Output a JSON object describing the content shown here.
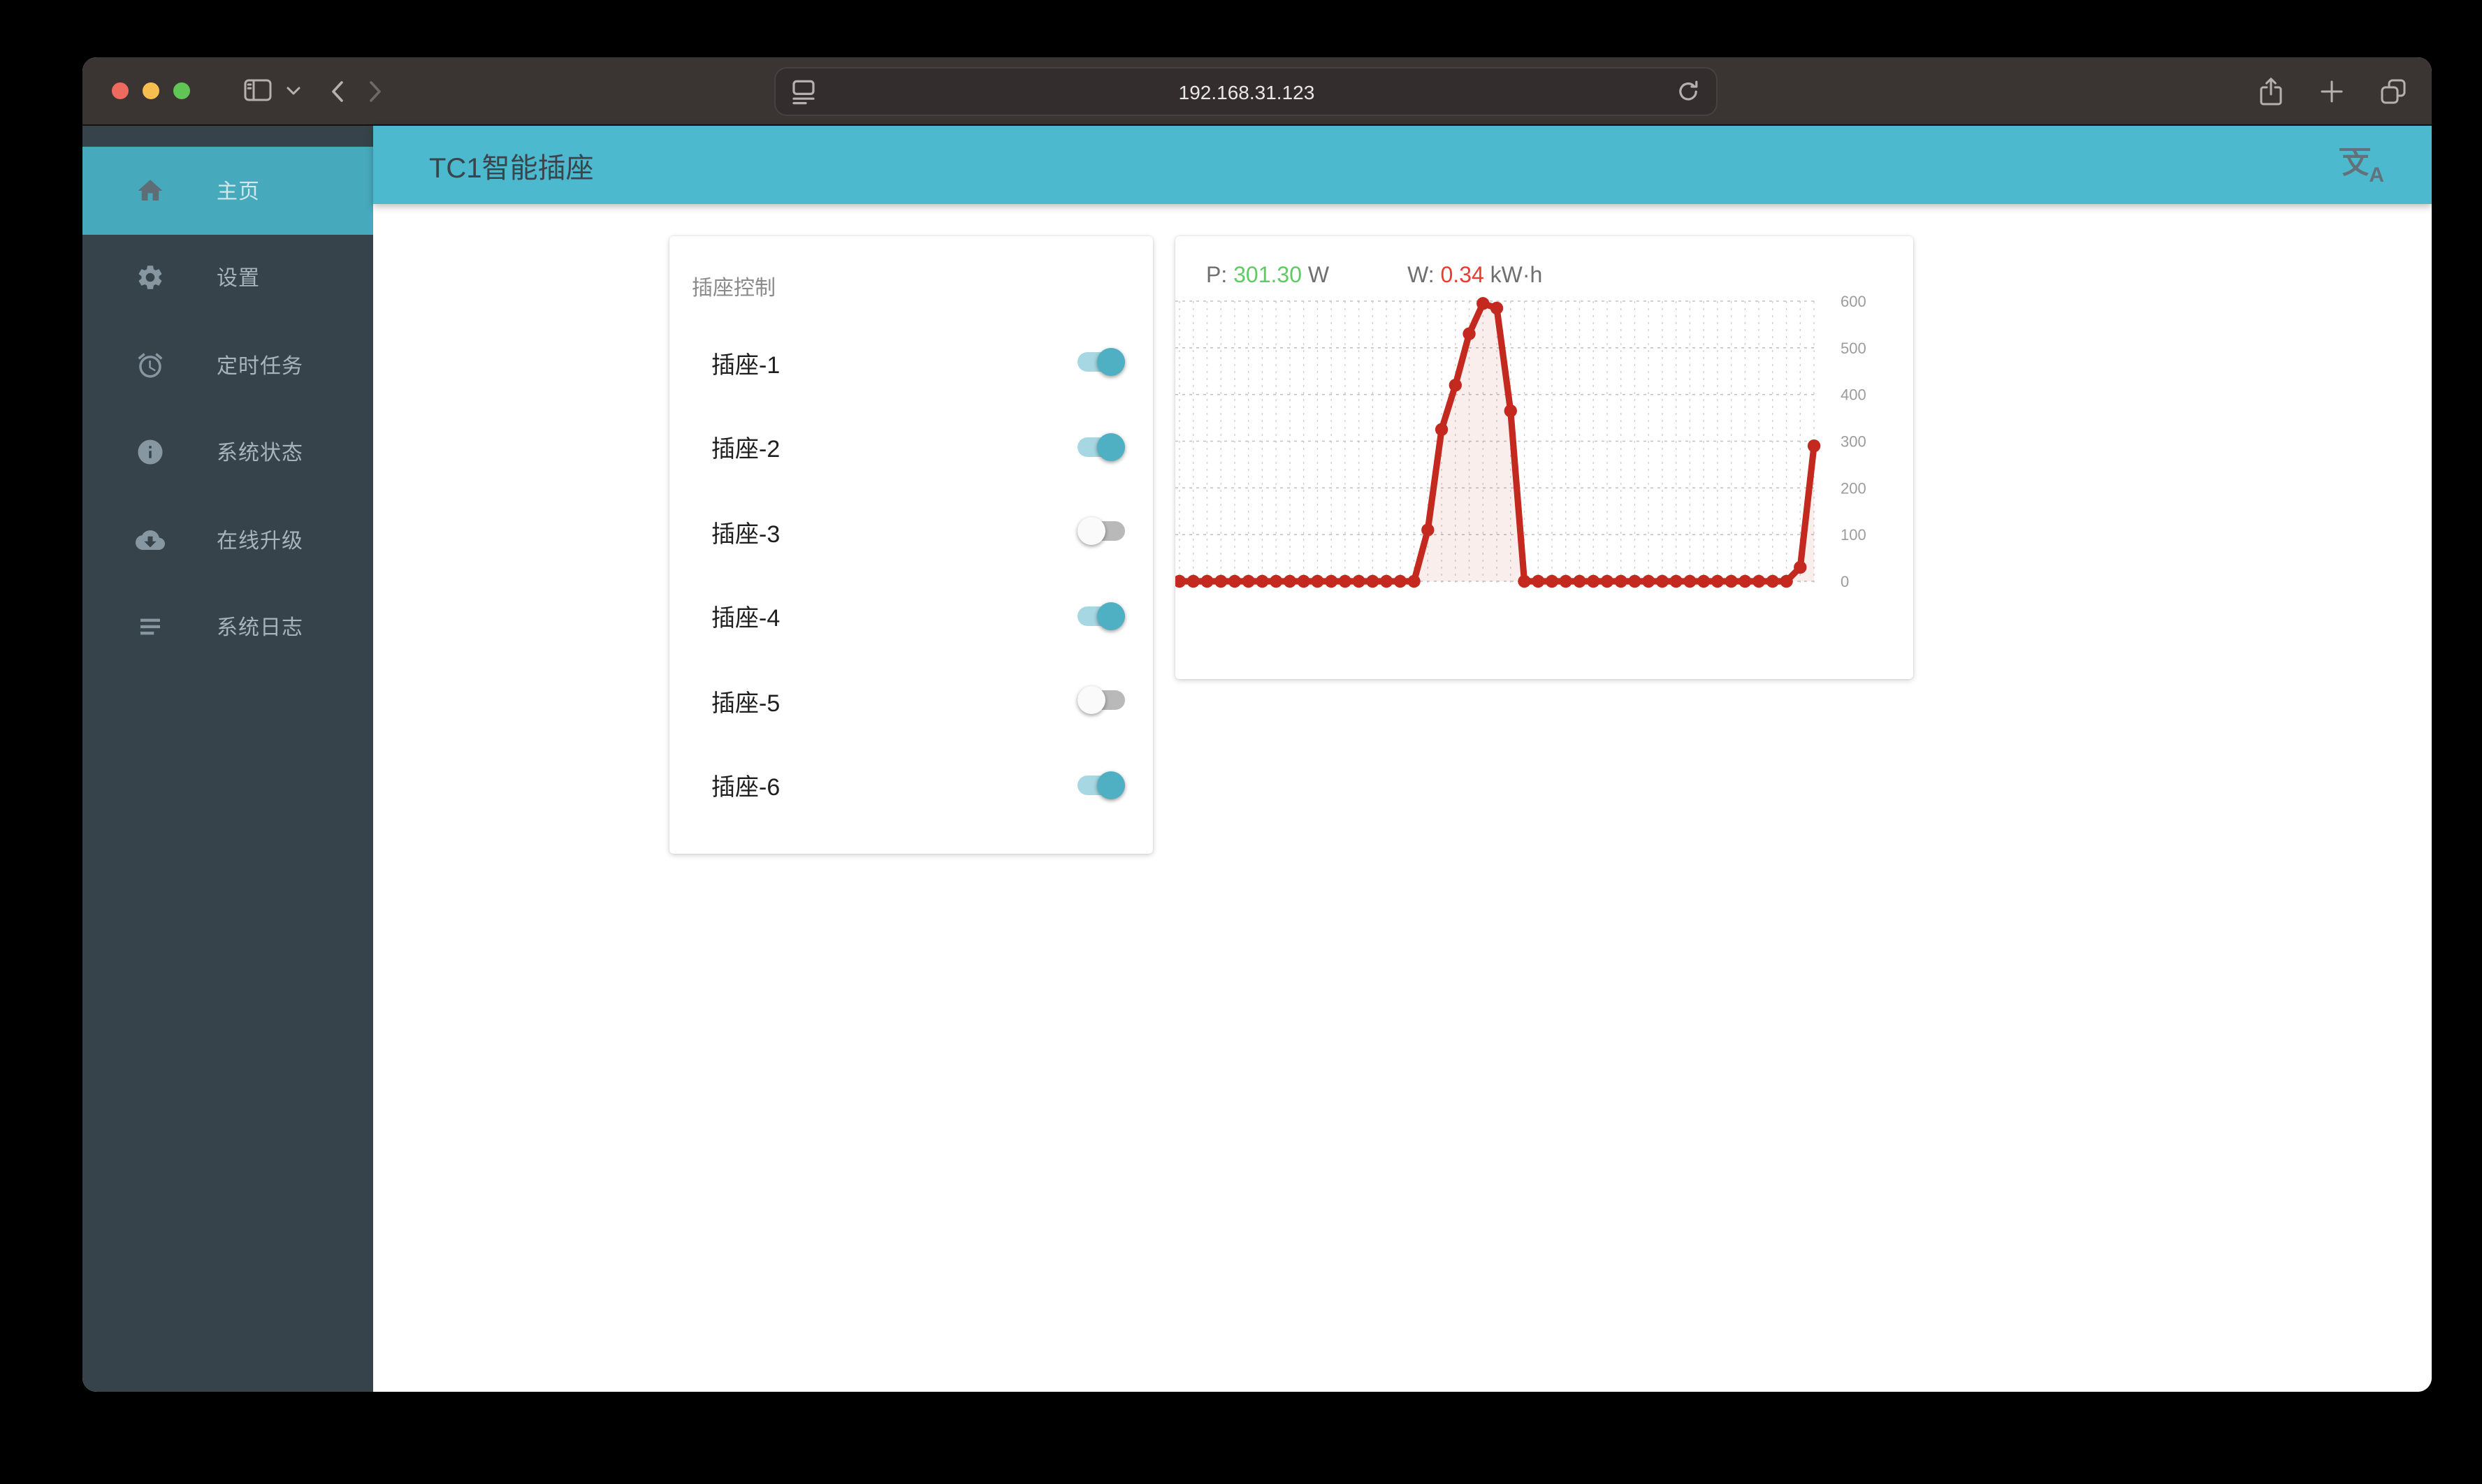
{
  "browser": {
    "url": "192.168.31.123",
    "icons": {
      "traffic_lights": [
        "close",
        "minimize",
        "fullscreen"
      ],
      "left": [
        "sidebar-toggle",
        "tab-group-chevron",
        "back",
        "forward"
      ],
      "url_field": [
        "page-settings",
        "reload"
      ],
      "right": [
        "share",
        "new-tab",
        "tabs-overview"
      ]
    }
  },
  "app": {
    "header": {
      "title": "TC1智能插座",
      "translate_icon": {
        "zh": "文",
        "latin": "A"
      }
    },
    "sidebar": {
      "items": [
        {
          "label": "主页",
          "icon": "home-icon",
          "active": true
        },
        {
          "label": "设置",
          "icon": "gear-icon",
          "active": false
        },
        {
          "label": "定时任务",
          "icon": "alarm-icon",
          "active": false
        },
        {
          "label": "系统状态",
          "icon": "info-icon",
          "active": false
        },
        {
          "label": "在线升级",
          "icon": "cloud-download-icon",
          "active": false
        },
        {
          "label": "系统日志",
          "icon": "log-lines-icon",
          "active": false
        }
      ]
    },
    "socket_card": {
      "title": "插座控制",
      "sockets": [
        {
          "label": "插座-1",
          "on": true
        },
        {
          "label": "插座-2",
          "on": true
        },
        {
          "label": "插座-3",
          "on": false
        },
        {
          "label": "插座-4",
          "on": true
        },
        {
          "label": "插座-5",
          "on": false
        },
        {
          "label": "插座-6",
          "on": true
        }
      ]
    },
    "chart_card": {
      "power": {
        "label": "P: ",
        "value": "301.30",
        "unit": " W"
      },
      "energy": {
        "label": "W: ",
        "value": "0.34",
        "unit": " kW·h"
      }
    }
  },
  "colors": {
    "accent_teal_header": "#4cb9ce",
    "accent_teal_active_item": "#47a9bc",
    "toggle_on_thumb": "#4fb0c4",
    "toggle_on_track": "#a7d7e2",
    "toggle_off_thumb": "#fafafa",
    "toggle_off_track": "#b9b9b9",
    "chart_line": "#c4291f",
    "chart_fill": "rgba(196,41,31,0.08)",
    "power_value_green": "#5ecb63",
    "energy_value_red": "#ef3a30",
    "sidebar_bg": "#37434b"
  },
  "chart_data": {
    "type": "line",
    "title": "",
    "xlabel": "",
    "ylabel": "",
    "ylim": [
      0,
      600
    ],
    "yticks": [
      600,
      500,
      400,
      300,
      200,
      100,
      0
    ],
    "ytick_side": "right",
    "grid": "dotted",
    "legend_position": "none",
    "marker": "circle",
    "series": [
      {
        "name": "power-W",
        "values": [
          0,
          0,
          0,
          0,
          0,
          0,
          0,
          0,
          0,
          0,
          0,
          0,
          0,
          0,
          0,
          0,
          0,
          0,
          110,
          325,
          420,
          530,
          595,
          585,
          365,
          0,
          0,
          0,
          0,
          0,
          0,
          0,
          0,
          0,
          0,
          0,
          0,
          0,
          0,
          0,
          0,
          0,
          0,
          0,
          0,
          30,
          290
        ]
      }
    ]
  }
}
